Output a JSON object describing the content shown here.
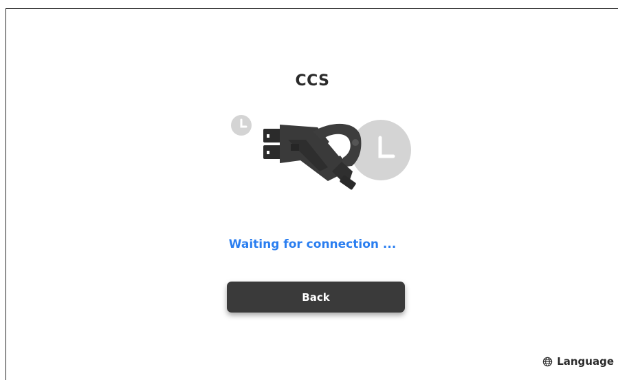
{
  "connector": {
    "title": "CCS"
  },
  "status": {
    "text": "Waiting for connection ..."
  },
  "actions": {
    "back_label": "Back"
  },
  "footer": {
    "language_label": "Language",
    "language_icon": "globe-icon"
  },
  "colors": {
    "status_text": "#2a7ef0",
    "button_bg": "#3a3a3a",
    "button_text": "#ffffff",
    "title_text": "#2a2a2a",
    "clock_gray": "#d4d4d4",
    "plug_dark": "#333333"
  }
}
